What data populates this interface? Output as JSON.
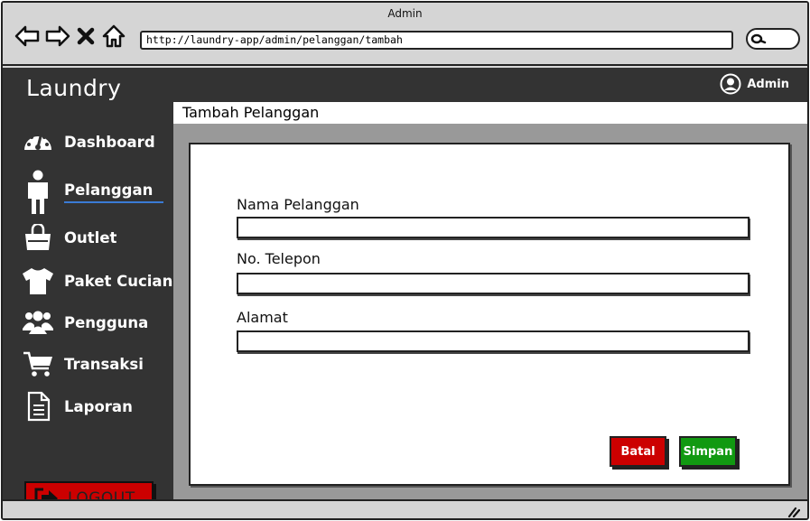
{
  "window": {
    "title": "Admin"
  },
  "browser": {
    "url": "http://laundry-app/admin/pelanggan/tambah"
  },
  "app": {
    "brand": "Laundry",
    "user_name": "Admin",
    "page_title": "Tambah Pelanggan"
  },
  "sidebar": {
    "items": [
      {
        "label": "Dashboard",
        "icon": "dashboard-icon"
      },
      {
        "label": "Pelanggan",
        "icon": "person-icon",
        "active": true
      },
      {
        "label": "Outlet",
        "icon": "shopping-bag-icon"
      },
      {
        "label": "Paket Cucian",
        "icon": "tshirt-icon"
      },
      {
        "label": "Pengguna",
        "icon": "users-icon"
      },
      {
        "label": "Transaksi",
        "icon": "cart-icon"
      },
      {
        "label": "Laporan",
        "icon": "document-icon"
      }
    ],
    "logout_label": "LOGOUT"
  },
  "form": {
    "fields": [
      {
        "label": "Nama Pelanggan",
        "value": ""
      },
      {
        "label": "No. Telepon",
        "value": ""
      },
      {
        "label": "Alamat",
        "value": ""
      }
    ],
    "cancel_label": "Batal",
    "save_label": "Simpan"
  },
  "colors": {
    "sidebar_bg": "#333333",
    "cancel_button": "#cc0000",
    "save_button": "#119911",
    "logout_button": "#cc0000",
    "active_underline": "#3a7bd5"
  }
}
